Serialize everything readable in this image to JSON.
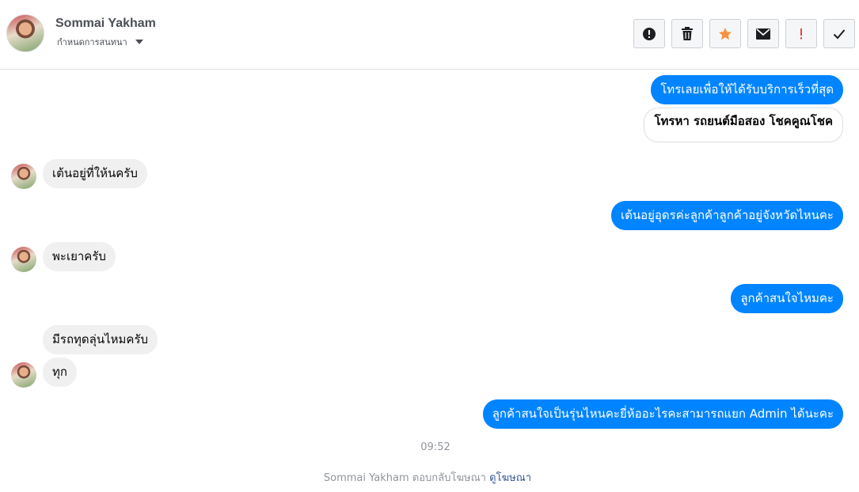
{
  "header": {
    "contact_name": "Sommai Yakham",
    "subtitle": "กำหนดการสนทนา",
    "toolbar": [
      {
        "name": "spam-button",
        "icon": "alert-circle-icon",
        "color": "#1c1e21"
      },
      {
        "name": "delete-button",
        "icon": "trash-icon",
        "color": "#1c1e21"
      },
      {
        "name": "star-button",
        "icon": "star-icon",
        "color": "#f5923e"
      },
      {
        "name": "mark-unread-button",
        "icon": "envelope-icon",
        "color": "#1c1e21"
      },
      {
        "name": "important-button",
        "icon": "exclamation-icon",
        "color": "#fa3e3e"
      },
      {
        "name": "done-button",
        "icon": "check-icon",
        "color": "#1c1e21"
      }
    ]
  },
  "messages": [
    {
      "from": "page",
      "text": "โทรเลยเพื่อให้ได้รับบริการเร็วที่สุด"
    },
    {
      "from": "page",
      "style": "button",
      "text": "โทรหา รถยนต์มือสอง โชคคูณโชค"
    },
    {
      "from": "user",
      "text": "เต้นอยู่ที่ให้นครับ"
    },
    {
      "from": "page",
      "text": "เต้นอยู่อุดรค่ะลูกค้าลูกค้าอยู่จังหวัดไหนคะ"
    },
    {
      "from": "user",
      "text": "พะเยาครับ"
    },
    {
      "from": "page",
      "text": "ลูกค้าสนใจไหมคะ"
    },
    {
      "from": "user",
      "text": "มีรถทุดลุ่นไหมครับ"
    },
    {
      "from": "user",
      "text": "ทุก"
    },
    {
      "from": "page",
      "text": "ลูกค้าสนใจเป็นรุ่นไหนคะยี่ห้ออะไรคะสามารถแยก Admin ได้นะคะ"
    }
  ],
  "timestamp": "09:52",
  "footer": {
    "text": "Sommai Yakham ตอบกลับโฆษณา",
    "link": "ดูโฆษณา"
  },
  "colors": {
    "outgoing_bubble": "#0084ff",
    "incoming_bubble": "#f1f0f0"
  }
}
